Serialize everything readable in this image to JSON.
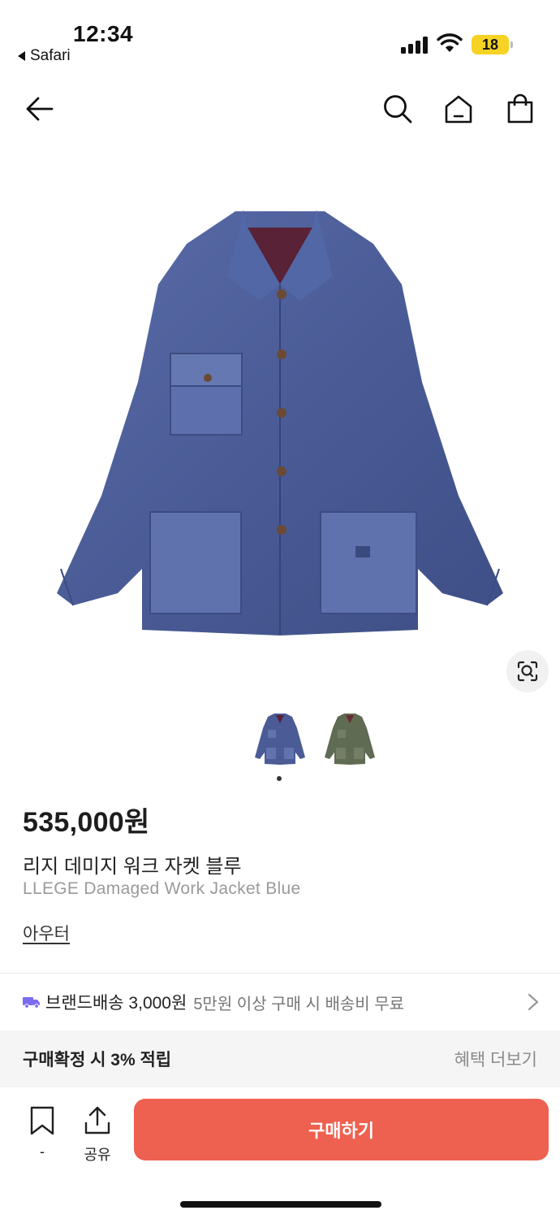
{
  "status_bar": {
    "time": "12:34",
    "back_app": "Safari",
    "battery": "18"
  },
  "nav": {
    "back_icon": "arrow-left-icon",
    "icons": [
      "search-icon",
      "home-icon",
      "shopping-bag-icon"
    ]
  },
  "product": {
    "price": "535,000원",
    "name_ko": "리지 데미지 워크 자켓 블루",
    "name_en": "LLEGE Damaged Work Jacket Blue",
    "category": "아우터",
    "main_color": "#4a5b96",
    "variant_colors": [
      "#4a5b96",
      "#5f6b52"
    ]
  },
  "shipping": {
    "label": "브랜드배송 3,000원",
    "note": "5만원 이상 구매 시 배송비 무료"
  },
  "benefit": {
    "label": "구매확정 시 3% 적립",
    "link": "혜택 더보기"
  },
  "bottom_bar": {
    "bookmark_count": "-",
    "share_label": "공유",
    "buy_label": "구매하기",
    "buy_color": "#ee6050"
  }
}
